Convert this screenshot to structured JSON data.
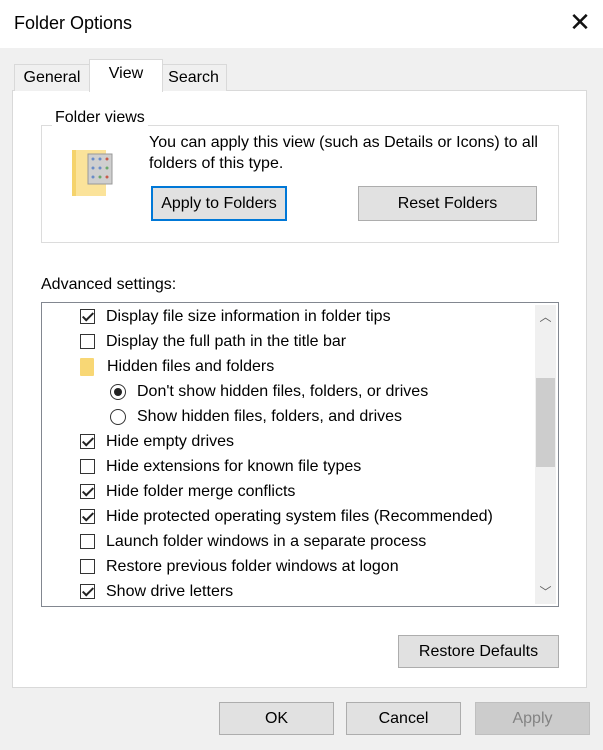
{
  "window": {
    "title": "Folder Options",
    "close_icon": "close-icon"
  },
  "tabs": [
    {
      "label": "General",
      "active": false
    },
    {
      "label": "View",
      "active": true
    },
    {
      "label": "Search",
      "active": false
    }
  ],
  "folder_views": {
    "legend": "Folder views",
    "description": "You can apply this view (such as Details or Icons) to all folders of this type.",
    "icon": "folder-view-icon",
    "apply_label": "Apply to Folders",
    "reset_label": "Reset Folders"
  },
  "advanced": {
    "label": "Advanced settings:",
    "items": [
      {
        "type": "checkbox",
        "label": "Display file size information in folder tips",
        "checked": true
      },
      {
        "type": "checkbox",
        "label": "Display the full path in the title bar",
        "checked": false
      },
      {
        "type": "folder",
        "label": "Hidden files and folders"
      },
      {
        "type": "radio",
        "label": "Don't show hidden files, folders, or drives",
        "checked": true
      },
      {
        "type": "radio",
        "label": "Show hidden files, folders, and drives",
        "checked": false
      },
      {
        "type": "checkbox",
        "label": "Hide empty drives",
        "checked": true
      },
      {
        "type": "checkbox",
        "label": "Hide extensions for known file types",
        "checked": false
      },
      {
        "type": "checkbox",
        "label": "Hide folder merge conflicts",
        "checked": true
      },
      {
        "type": "checkbox",
        "label": "Hide protected operating system files (Recommended)",
        "checked": true
      },
      {
        "type": "checkbox",
        "label": "Launch folder windows in a separate process",
        "checked": false
      },
      {
        "type": "checkbox",
        "label": "Restore previous folder windows at logon",
        "checked": false
      },
      {
        "type": "checkbox",
        "label": "Show drive letters",
        "checked": true
      }
    ],
    "scroll": {
      "thumb_start_fraction": 0.2,
      "thumb_size_fraction": 0.35
    },
    "restore_defaults_label": "Restore Defaults"
  },
  "footer": {
    "ok_label": "OK",
    "cancel_label": "Cancel",
    "apply_label": "Apply",
    "apply_enabled": false
  },
  "colors": {
    "accent": "#0078d7",
    "folder": "#f8d775"
  }
}
